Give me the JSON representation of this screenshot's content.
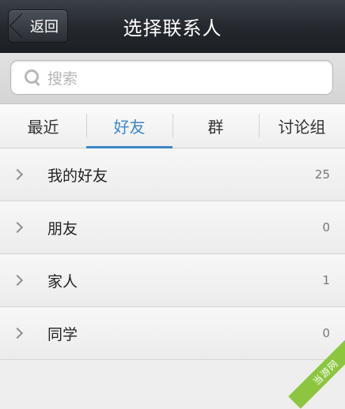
{
  "header": {
    "back_label": "返回",
    "title": "选择联系人"
  },
  "search": {
    "placeholder": "搜索"
  },
  "tabs": [
    {
      "label": "最近",
      "active": false
    },
    {
      "label": "好友",
      "active": true
    },
    {
      "label": "群",
      "active": false
    },
    {
      "label": "讨论组",
      "active": false
    }
  ],
  "groups": [
    {
      "name": "我的好友",
      "count": "25"
    },
    {
      "name": "朋友",
      "count": "0"
    },
    {
      "name": "家人",
      "count": "1"
    },
    {
      "name": "同学",
      "count": "0"
    }
  ],
  "watermark": "当游网",
  "colors": {
    "accent": "#3d86c6",
    "header_bg": "#24282e",
    "watermark_bg": "#8cc63f"
  }
}
